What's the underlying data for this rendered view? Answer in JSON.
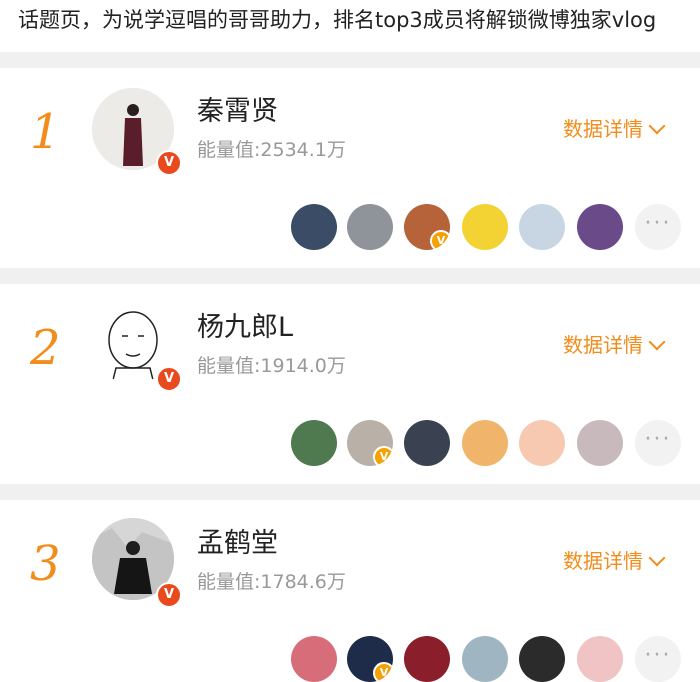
{
  "header": {
    "text": "话题页，为说学逗唱的哥哥助力，排名top3成员将解锁微博独家vlog"
  },
  "ranking": [
    {
      "rank": "1",
      "name": "秦霄贤",
      "energy": "能量值:2534.1万",
      "detail_label": "数据详情",
      "badge_color": "#e8491d",
      "fans": [
        {
          "color": "#3b4d66",
          "verified": false
        },
        {
          "color": "#8f949a",
          "verified": false
        },
        {
          "color": "#b6633a",
          "verified": true
        },
        {
          "color": "#f3d233",
          "verified": false
        },
        {
          "color": "#c7d6e2",
          "verified": false
        },
        {
          "color": "#6b4a8a",
          "verified": false
        }
      ]
    },
    {
      "rank": "2",
      "name": "杨九郎L",
      "energy": "能量值:1914.0万",
      "detail_label": "数据详情",
      "badge_color": "#e8491d",
      "fans": [
        {
          "color": "#4f7a4f",
          "verified": false
        },
        {
          "color": "#b9b1a8",
          "verified": true
        },
        {
          "color": "#3a4150",
          "verified": false
        },
        {
          "color": "#f0b46a",
          "verified": false
        },
        {
          "color": "#f7c9b0",
          "verified": false
        },
        {
          "color": "#c8b9bd",
          "verified": false
        }
      ]
    },
    {
      "rank": "3",
      "name": "孟鹤堂",
      "energy": "能量值:1784.6万",
      "detail_label": "数据详情",
      "badge_color": "#e8491d",
      "fans": [
        {
          "color": "#d86d7a",
          "verified": false
        },
        {
          "color": "#1e2c4a",
          "verified": true
        },
        {
          "color": "#8a1f2b",
          "verified": false
        },
        {
          "color": "#9fb6c2",
          "verified": false
        },
        {
          "color": "#2b2b2b",
          "verified": false
        },
        {
          "color": "#f0c4c4",
          "verified": false
        }
      ]
    }
  ],
  "more_label": "···",
  "accent": "#f28c1a"
}
